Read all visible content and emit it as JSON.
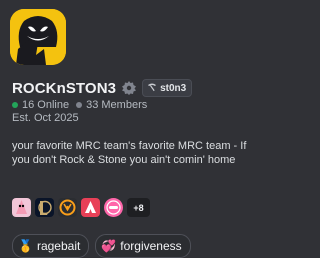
{
  "server": {
    "name": "ROCKnSTON3",
    "tag": "st0n3",
    "online": "16 Online",
    "members": "33 Members",
    "established": "Est. Oct 2025",
    "description": "your favorite MRC team's favorite MRC team - If you don't Rock & Stone you ain't comin' home"
  },
  "icons": {
    "verified": "gear-badge-icon",
    "tag": "pickaxe-icon"
  },
  "games": [
    {
      "name": "patrick-icon",
      "color": "#f2c6d8"
    },
    {
      "name": "league-of-legends-icon",
      "color": "#0a1428"
    },
    {
      "name": "overwatch-icon",
      "color": "#2b2d31"
    },
    {
      "name": "valorant-icon",
      "color": "#e84057"
    },
    {
      "name": "osu-icon",
      "color": "#ff66aa"
    }
  ],
  "games_more": "+8",
  "traits": [
    {
      "emoji": "🥇",
      "label": "ragebait"
    },
    {
      "emoji": "💞",
      "label": "forgiveness"
    }
  ],
  "colors": {
    "background": "#303136",
    "online": "#23a55a",
    "icon_bg": "#f4c20f"
  }
}
